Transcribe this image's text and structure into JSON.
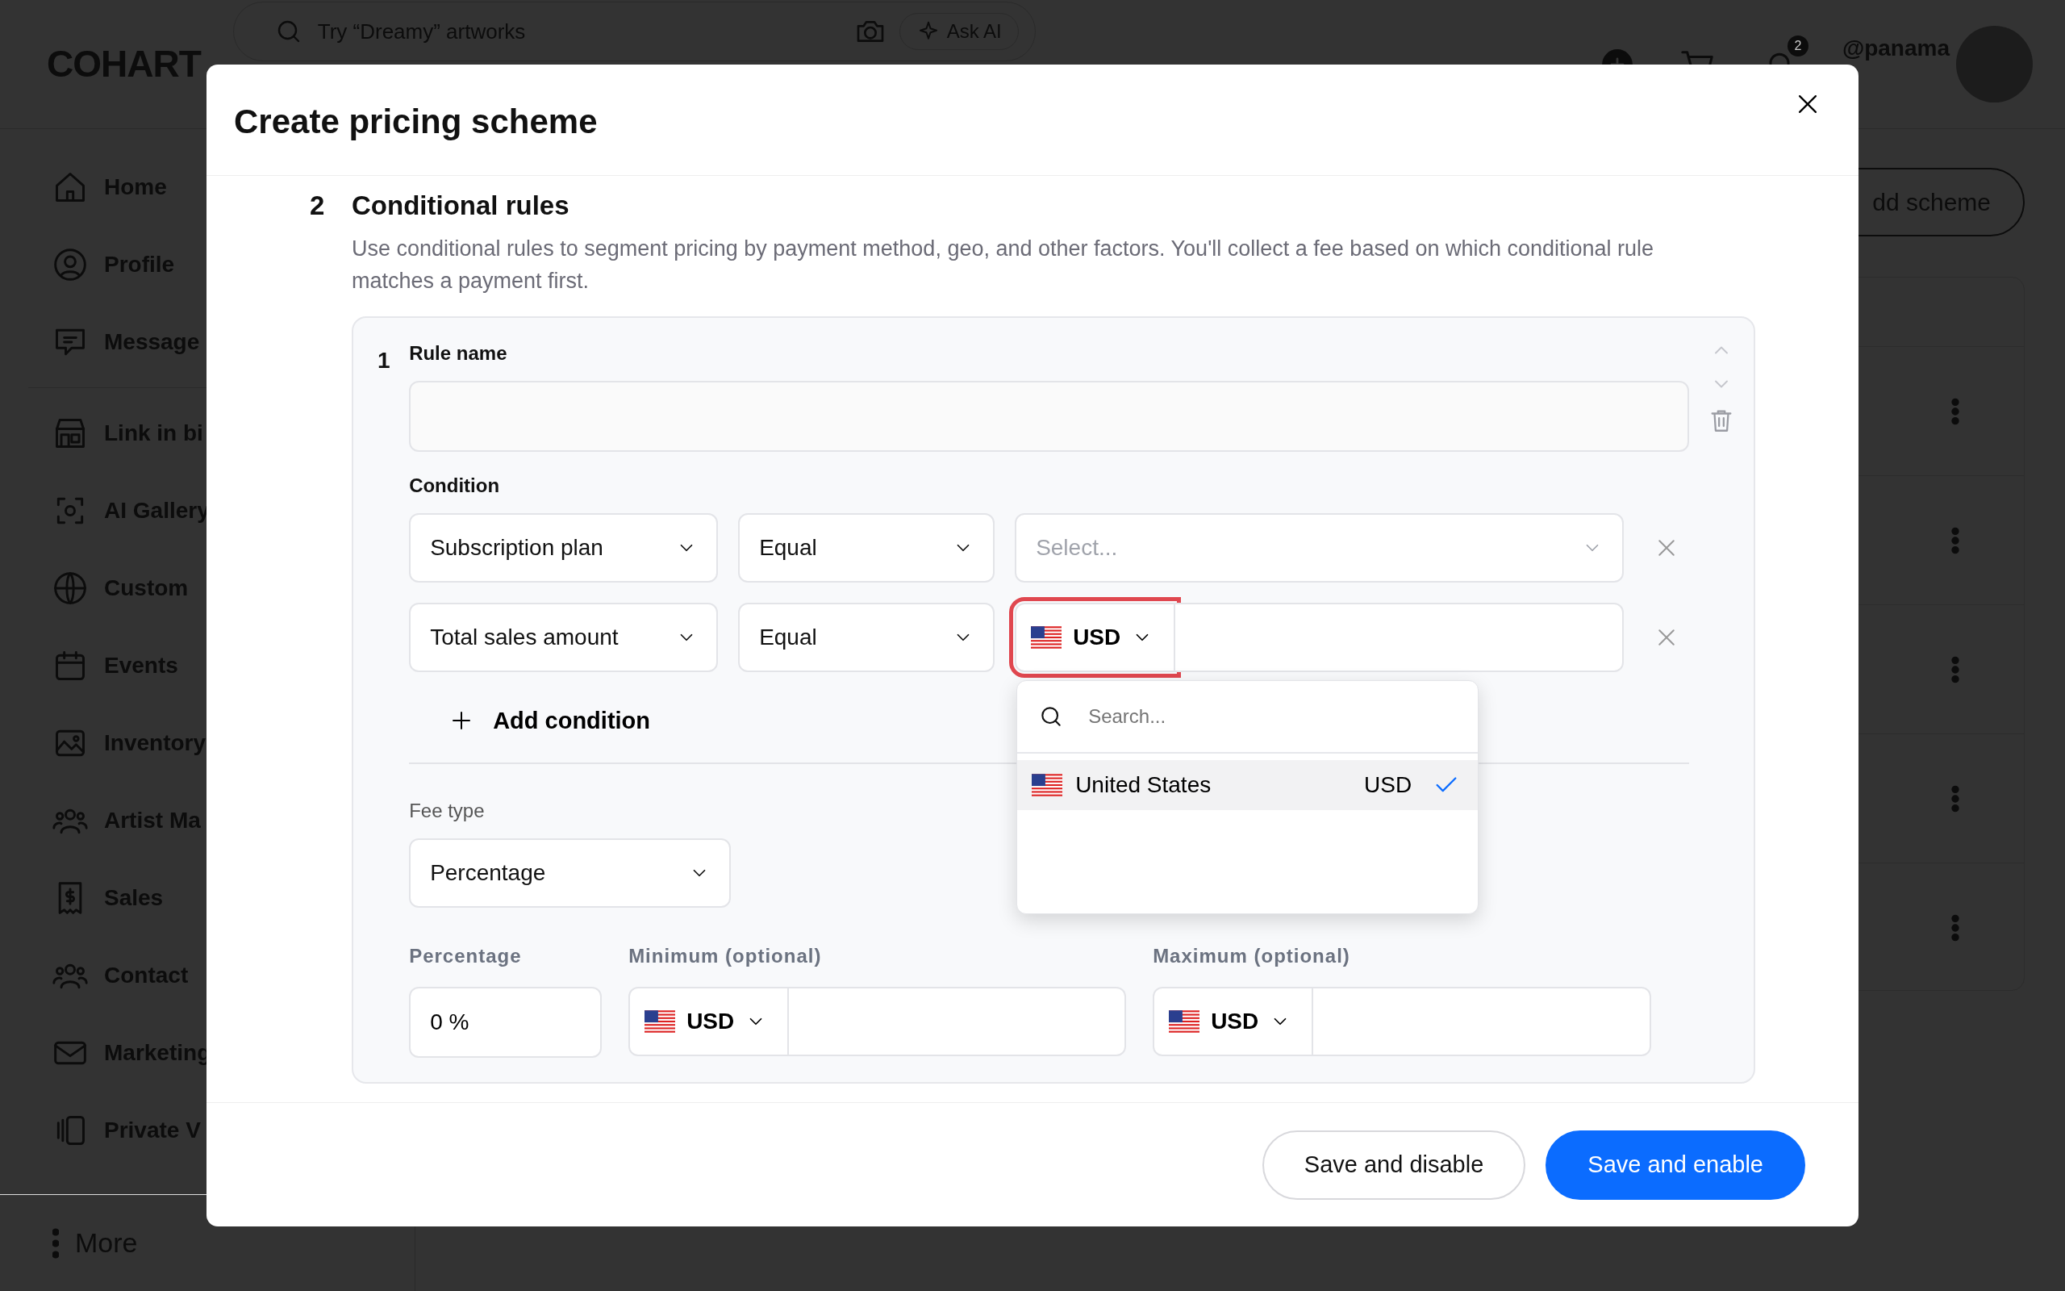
{
  "top_bar": {
    "logo": "COHART",
    "search": {
      "placeholder": "Try “Dreamy” artworks"
    },
    "ask_ai": "Ask AI",
    "notification_count": "2",
    "username": "@panama"
  },
  "sidebar": {
    "groups": [
      [
        {
          "label": "Home"
        },
        {
          "label": "Profile"
        },
        {
          "label": "Message"
        }
      ],
      [
        {
          "label": "Link in bi"
        },
        {
          "label": "AI Gallery"
        },
        {
          "label": "Custom"
        },
        {
          "label": "Events"
        },
        {
          "label": "Inventory"
        },
        {
          "label": "Artist Ma"
        },
        {
          "label": "Sales"
        },
        {
          "label": "Contact"
        },
        {
          "label": "Marketing"
        },
        {
          "label": "Private V"
        }
      ]
    ],
    "more": "More"
  },
  "page": {
    "add_button": "dd scheme"
  },
  "modal": {
    "title": "Create pricing scheme",
    "section": {
      "number": "2",
      "title": "Conditional rules",
      "description": "Use conditional rules to segment pricing by payment method, geo, and other factors. You'll collect a fee based on which conditional rule matches a payment first."
    },
    "rule": {
      "number": "1",
      "name_label": "Rule name",
      "condition_label": "Condition",
      "conditions": [
        {
          "field": "Subscription plan",
          "operator": "Equal",
          "kind": "select",
          "placeholder": "Select..."
        },
        {
          "field": "Total sales amount",
          "operator": "Equal",
          "kind": "currency",
          "currency": "USD",
          "focused": true
        }
      ],
      "add_condition": "Add condition",
      "fee_type_label": "Fee type",
      "fee_type": "Percentage",
      "percentage_label": "Percentage",
      "percentage_value": "0 %",
      "minimum_label": "Minimum (optional)",
      "minimum_currency": "USD",
      "maximum_label": "Maximum (optional)",
      "maximum_currency": "USD"
    },
    "currency_menu": {
      "search_placeholder": "Search...",
      "options": [
        {
          "country": "United States",
          "currency": "USD",
          "selected": true
        }
      ]
    },
    "buttons": [
      {
        "label": "Save and disable",
        "kind": "secondary"
      },
      {
        "label": "Save and enable",
        "kind": "primary"
      }
    ]
  }
}
